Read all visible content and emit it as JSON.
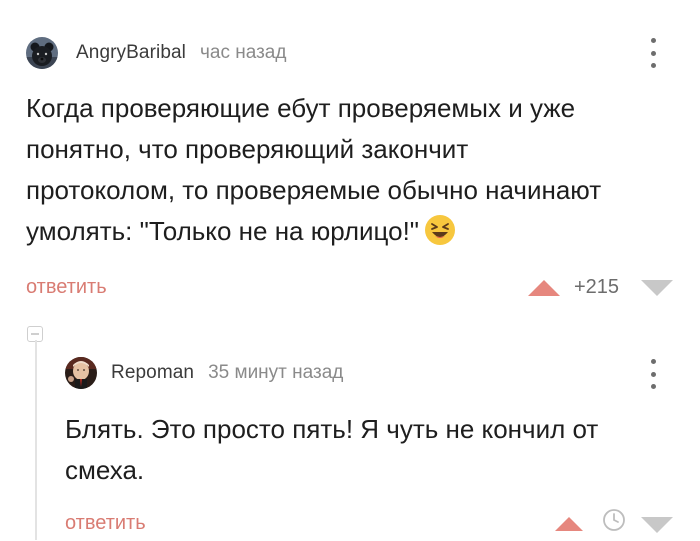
{
  "comments": [
    {
      "author": "AngryBaribal",
      "time": "час назад",
      "text": "Когда проверяющие ебут проверяемых и уже\nпонятно, что проверяющий закончит\nпротоколом, то проверяемые обычно начинают\nумолять: \"Только не на юрлицо!\"",
      "emoji": "laughing-emoji",
      "reply_label": "ответить",
      "rating": "+215",
      "avatar": "bear-avatar"
    },
    {
      "author": "Repoman",
      "time": "35 минут назад",
      "text": "Блять. Это просто пять! Я чуть не кончил от\nсмеха.",
      "reply_label": "ответить",
      "avatar": "man-avatar"
    }
  ],
  "colors": {
    "reply_link": "#d97c73",
    "upvote": "#e6877e",
    "downvote": "#c8c8c8",
    "timestamp": "#8a8a8a"
  }
}
